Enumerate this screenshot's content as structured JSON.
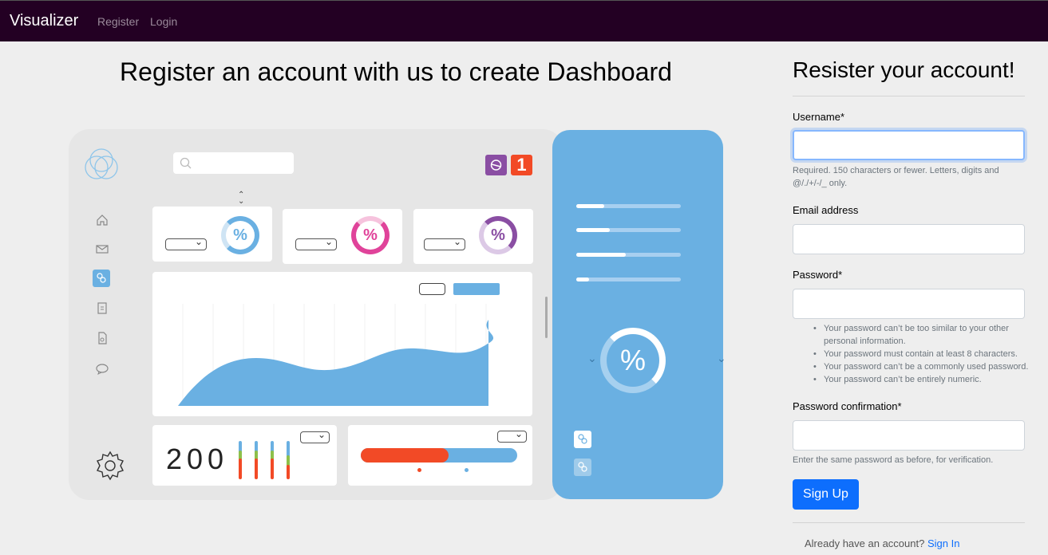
{
  "nav": {
    "brand": "Visualizer",
    "register": "Register",
    "login": "Login"
  },
  "hero": {
    "title": "Register an account with us to create Dashboard"
  },
  "illustration": {
    "percent_symbol": "%",
    "notification_count": "1",
    "big_number": "200",
    "progress_lines": [
      0.27,
      0.32,
      0.47,
      0.12
    ],
    "colors": {
      "blue": "#6ab0e2",
      "pink": "#e0439a",
      "purple": "#8a4ea3",
      "red": "#f24a26",
      "green": "#8dc04a"
    }
  },
  "form": {
    "title": "Resister your account!",
    "username_label": "Username*",
    "username_value": "",
    "username_help": "Required. 150 characters or fewer. Letters, digits and @/./+/-/_ only.",
    "email_label": "Email address",
    "email_value": "",
    "password_label": "Password*",
    "password_rules": [
      "Your password can’t be too similar to your other personal information.",
      "Your password must contain at least 8 characters.",
      "Your password can’t be a commonly used password.",
      "Your password can’t be entirely numeric."
    ],
    "password2_label": "Password confirmation*",
    "password2_help": "Enter the same password as before, for verification.",
    "submit_label": "Sign Up",
    "footer_text": "Already have an account?",
    "footer_link": "Sign In"
  }
}
